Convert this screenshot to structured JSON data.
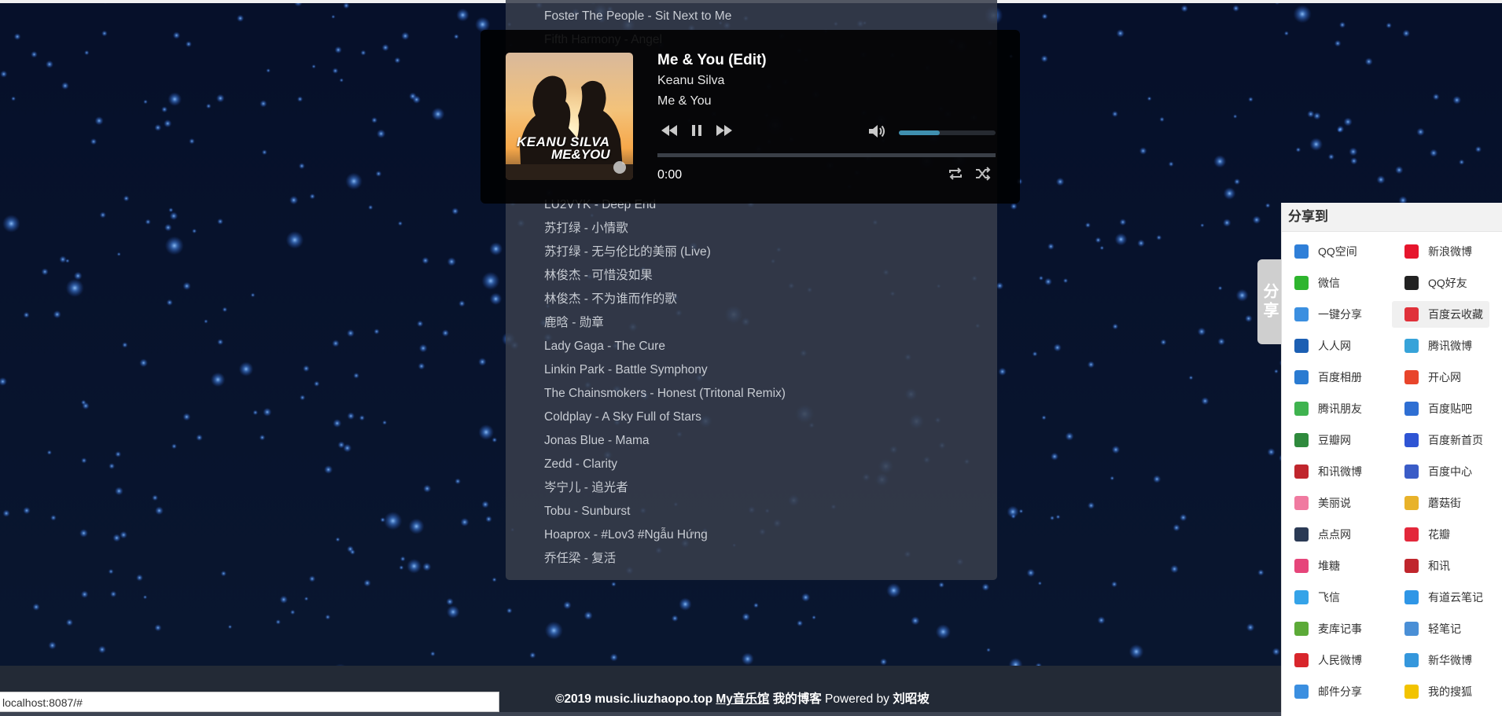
{
  "player": {
    "title": "Me & You (Edit)",
    "artist": "Keanu Silva",
    "album": "Me & You",
    "time": "0:00",
    "cover_line1": "KEANU SILVA",
    "cover_line2": "ME&YOU",
    "progress": 0.0,
    "volume": 0.42,
    "controls": [
      "previous-icon",
      "pause-icon",
      "next-icon",
      "volume-icon",
      "repeat-icon",
      "shuffle-icon"
    ]
  },
  "playlist": [
    "Foster The People - Sit Next to Me",
    "Fifth Harmony - Angel",
    "",
    "",
    "",
    "",
    "",
    "",
    "LU2VYK - Deep End",
    "苏打绿 - 小情歌",
    "苏打绿 - 无与伦比的美丽 (Live)",
    "林俊杰 - 可惜没如果",
    "林俊杰 - 不为谁而作的歌",
    "鹿晗 - 勋章",
    "Lady Gaga - The Cure",
    "Linkin Park - Battle Symphony",
    "The Chainsmokers - Honest (Tritonal Remix)",
    "Coldplay - A Sky Full of Stars",
    "Jonas Blue - Mama",
    "Zedd - Clarity",
    "岑宁儿 - 追光者",
    "Tobu - Sunburst",
    "Hoaprox - #Lov3 #Ngẫu Hứng",
    "乔任梁 - 复活"
  ],
  "share": {
    "tab_label": "分享",
    "heading": "分享到",
    "items": [
      {
        "label": "QQ空间",
        "icon": "qzone-icon",
        "color": "#2f7fd8"
      },
      {
        "label": "新浪微博",
        "icon": "weibo-icon",
        "color": "#e6162d"
      },
      {
        "label": "微信",
        "icon": "wechat-icon",
        "color": "#2eb52e"
      },
      {
        "label": "QQ好友",
        "icon": "qq-icon",
        "color": "#222222"
      },
      {
        "label": "一键分享",
        "icon": "onekey-icon",
        "color": "#3b8fe0"
      },
      {
        "label": "百度云收藏",
        "icon": "heart-icon",
        "color": "#e0313a"
      },
      {
        "label": "人人网",
        "icon": "renren-icon",
        "color": "#1c5fb3"
      },
      {
        "label": "腾讯微博",
        "icon": "tqq-icon",
        "color": "#37a3d9"
      },
      {
        "label": "百度相册",
        "icon": "baidu-album-icon",
        "color": "#2a7bd1"
      },
      {
        "label": "开心网",
        "icon": "kaixin-icon",
        "color": "#e8452b"
      },
      {
        "label": "腾讯朋友",
        "icon": "clover-icon",
        "color": "#3fb34f"
      },
      {
        "label": "百度贴吧",
        "icon": "tieba-icon",
        "color": "#2f6fd3"
      },
      {
        "label": "豆瓣网",
        "icon": "douban-icon",
        "color": "#2f8a3d"
      },
      {
        "label": "百度新首页",
        "icon": "baidu-paw-icon",
        "color": "#2f55d4"
      },
      {
        "label": "和讯微博",
        "icon": "hexun-weibo-icon",
        "color": "#c0262d"
      },
      {
        "label": "百度中心",
        "icon": "baidu-center-icon",
        "color": "#3a5cc7"
      },
      {
        "label": "美丽说",
        "icon": "meilishuo-icon",
        "color": "#f07aa0"
      },
      {
        "label": "蘑菇街",
        "icon": "mogujie-icon",
        "color": "#e8b22a"
      },
      {
        "label": "点点网",
        "icon": "diandian-icon",
        "color": "#2b3a55"
      },
      {
        "label": "花瓣",
        "icon": "huaban-icon",
        "color": "#e3283b"
      },
      {
        "label": "堆糖",
        "icon": "duitang-icon",
        "color": "#e6457a"
      },
      {
        "label": "和讯",
        "icon": "hexun-icon",
        "color": "#c0262d"
      },
      {
        "label": "飞信",
        "icon": "fetion-icon",
        "color": "#35a3e8"
      },
      {
        "label": "有道云笔记",
        "icon": "youdao-icon",
        "color": "#2f96e6"
      },
      {
        "label": "麦库记事",
        "icon": "maiku-icon",
        "color": "#5caa38"
      },
      {
        "label": "轻笔记",
        "icon": "qingbiji-icon",
        "color": "#4a8fd6"
      },
      {
        "label": "人民微博",
        "icon": "people-weibo-icon",
        "color": "#d8262c"
      },
      {
        "label": "新华微博",
        "icon": "xinhua-icon",
        "color": "#3597dc"
      },
      {
        "label": "邮件分享",
        "icon": "mail-icon",
        "color": "#3b8fe0"
      },
      {
        "label": "我的搜狐",
        "icon": "sohu-icon",
        "color": "#f2c300"
      }
    ]
  },
  "footer": {
    "copyright": "©2019 music.liuzhaopo.top",
    "site_link": "My音乐馆",
    "blog_link": "我的博客",
    "powered": "Powered by",
    "author": "刘昭坡"
  },
  "statusbar": {
    "url": "localhost:8087/#"
  },
  "colors": {
    "background": "#061024",
    "accent": "#5aa9c5",
    "panel": "#383e4c"
  }
}
